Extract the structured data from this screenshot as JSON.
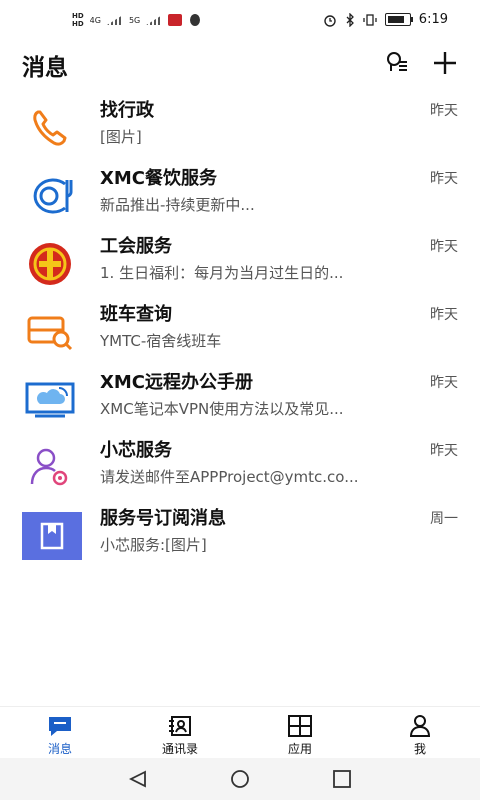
{
  "status_bar": {
    "time": "6:19",
    "network_1": "4G",
    "network_2": "5G"
  },
  "header": {
    "title": "消息",
    "search_icon": "search-person-icon",
    "add_icon": "plus-icon"
  },
  "conversations": [
    {
      "name": "找行政",
      "preview": "[图片]",
      "time": "昨天",
      "icon": "phone-icon",
      "color": "#f07d1a"
    },
    {
      "name": "XMC餐饮服务",
      "preview": "新品推出-持续更新中...",
      "time": "昨天",
      "icon": "dining-icon",
      "color": "#1c6ccf"
    },
    {
      "name": "工会服务",
      "preview": "1. 生日福利：每月为当月过生日的...",
      "time": "昨天",
      "icon": "union-emblem-icon",
      "color": "#d42a1c"
    },
    {
      "name": "班车查询",
      "preview": "YMTC-宿舍线班车",
      "time": "昨天",
      "icon": "bus-search-icon",
      "color": "#f07d1a"
    },
    {
      "name": "XMC远程办公手册",
      "preview": "XMC笔记本VPN使用方法以及常见...",
      "time": "昨天",
      "icon": "cloud-laptop-icon",
      "color": "#1c6ccf"
    },
    {
      "name": "小芯服务",
      "preview": "请发送邮件至APPProject@ymtc.co...",
      "time": "昨天",
      "icon": "user-gear-icon",
      "color": "#8a4fc7"
    },
    {
      "name": "服务号订阅消息",
      "preview": "小芯服务:[图片]",
      "time": "周一",
      "icon": "bookmark-icon",
      "color": "#5a6fe0"
    }
  ],
  "tabs": [
    {
      "label": "消息",
      "icon": "chat-icon",
      "active": true
    },
    {
      "label": "通讯录",
      "icon": "contacts-icon",
      "active": false
    },
    {
      "label": "应用",
      "icon": "apps-grid-icon",
      "active": false
    },
    {
      "label": "我",
      "icon": "person-icon",
      "active": false
    }
  ],
  "nav": [
    "back-icon",
    "home-icon",
    "recents-icon"
  ],
  "colors": {
    "accent": "#1b5fc7"
  }
}
